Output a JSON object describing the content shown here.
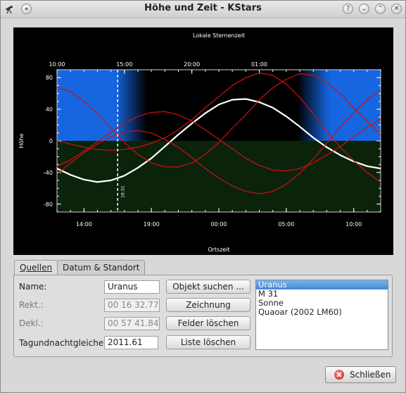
{
  "window": {
    "title": "Höhe und Zeit - KStars",
    "buttons": {
      "help": "?",
      "minimize": "⌄",
      "maximize": "⌃",
      "close": "✕"
    }
  },
  "chart_data": {
    "type": "line",
    "title": "Lokale Sternenzeit",
    "xlabel": "Ortszeit",
    "ylabel": "Höhe",
    "ylim": [
      -90,
      90
    ],
    "yticks": [
      80,
      40,
      0,
      -40,
      -80
    ],
    "bottom_ticks": [
      "14:00",
      "19:00",
      "00:00",
      "05:00",
      "10:00"
    ],
    "top_ticks": [
      "10:00",
      "15:00",
      "20:00",
      "01:00"
    ],
    "x_hours": [
      12,
      36
    ],
    "day_bands": [
      {
        "from": 12,
        "to": 17.5
      },
      {
        "from": 31,
        "to": 36
      }
    ],
    "night_band": {
      "from": 17.5,
      "to": 31
    },
    "grid": false,
    "now_marker": {
      "hour": 16.5,
      "label": "16:31"
    },
    "series": [
      {
        "color": "#ffffff",
        "x": [
          12,
          13,
          14,
          15,
          16,
          17,
          18,
          19,
          20,
          21,
          22,
          23,
          24,
          25,
          26,
          27,
          28,
          29,
          30,
          31,
          32,
          33,
          34,
          35,
          36
        ],
        "y": [
          -35,
          -43,
          -49,
          -52,
          -50,
          -44,
          -34,
          -22,
          -7,
          8,
          22,
          35,
          46,
          52,
          53,
          49,
          42,
          31,
          18,
          4,
          -8,
          -18,
          -26,
          -32,
          -35
        ]
      },
      {
        "color": "#d01010",
        "x": [
          12,
          13,
          14,
          15,
          16,
          17,
          18,
          19,
          20,
          21,
          22,
          23,
          24,
          25,
          26,
          27,
          28,
          29,
          30,
          31,
          32,
          33,
          34,
          35,
          36
        ],
        "y": [
          -32,
          -24,
          -13,
          -1,
          11,
          22,
          31,
          36,
          37,
          33,
          25,
          14,
          2,
          -10,
          -22,
          -31,
          -37,
          -38,
          -35,
          -28,
          -18,
          -7,
          5,
          17,
          28
        ]
      },
      {
        "color": "#d01010",
        "x": [
          12,
          13,
          14,
          15,
          16,
          17,
          18,
          19,
          20,
          21,
          22,
          23,
          24,
          25,
          26,
          27,
          28,
          29,
          30,
          31,
          32,
          33,
          34,
          35,
          36
        ],
        "y": [
          68,
          62,
          50,
          34,
          16,
          -2,
          -17,
          -28,
          -33,
          -33,
          -28,
          -17,
          -2,
          16,
          33,
          52,
          67,
          78,
          85,
          83,
          74,
          60,
          42,
          25,
          8
        ]
      },
      {
        "color": "#d01010",
        "x": [
          12,
          13,
          14,
          15,
          16,
          17,
          18,
          19,
          20,
          21,
          22,
          23,
          24,
          25,
          26,
          27,
          28,
          29,
          30,
          31,
          32,
          33,
          34,
          35,
          36
        ],
        "y": [
          0,
          -4,
          -8,
          -11,
          -12,
          -11,
          -8,
          -3,
          4,
          14,
          27,
          42,
          56,
          70,
          80,
          86,
          83,
          72,
          55,
          34,
          12,
          -8,
          -25,
          -40,
          -52
        ]
      },
      {
        "color": "#d01010",
        "x": [
          12,
          13,
          14,
          15,
          16,
          17,
          18,
          19,
          20,
          21,
          22,
          23,
          24,
          25,
          26,
          27,
          28,
          29,
          30,
          31,
          32,
          33,
          34,
          35,
          36
        ],
        "y": [
          -42,
          -28,
          -15,
          -4,
          5,
          11,
          13,
          10,
          2,
          -8,
          -21,
          -35,
          -47,
          -57,
          -64,
          -67,
          -64,
          -55,
          -41,
          -23,
          -3,
          17,
          36,
          52,
          64
        ]
      }
    ]
  },
  "tabs": [
    {
      "label": "Quellen",
      "active": true
    },
    {
      "label": "Datum & Standort",
      "active": false
    }
  ],
  "form": {
    "name_label": "Name:",
    "name_value": "Uranus",
    "ra_label": "Rekt.:",
    "ra_value": "00 16 32.77",
    "dec_label": "Dekl.:",
    "dec_value": "00 57 41.84",
    "epoch_label": "Tagundnachtgleiche:",
    "epoch_value": "2011.61"
  },
  "buttons": {
    "find_object": "Objekt suchen ...",
    "plot": "Zeichnung",
    "clear_fields": "Felder löschen",
    "clear_list": "Liste löschen",
    "close": "Schließen"
  },
  "object_list": {
    "items": [
      "Uranus",
      "M 31",
      "Sonne",
      "Quaoar (2002 LM60)"
    ],
    "selected": 0
  }
}
